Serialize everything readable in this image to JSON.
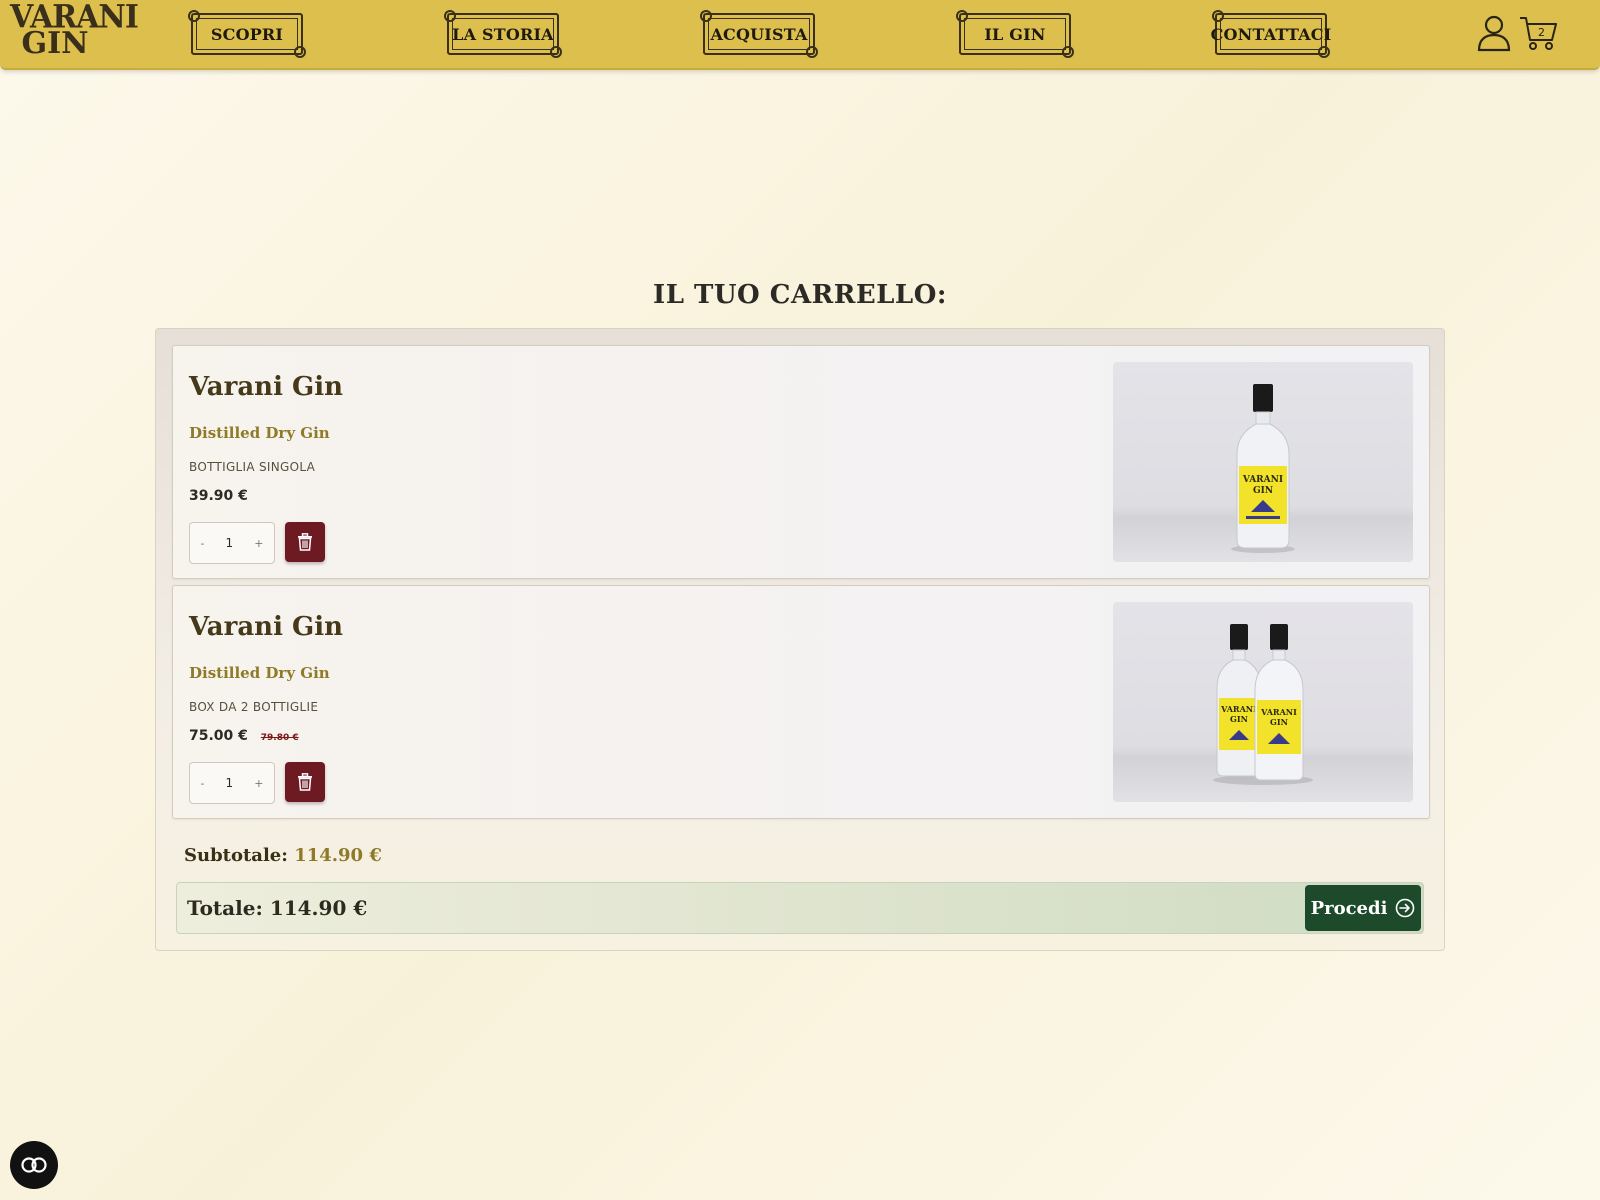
{
  "header": {
    "logo_line1": "VARANI",
    "logo_line2": "GIN",
    "nav": [
      {
        "label": "Scopri"
      },
      {
        "label": "La Storia"
      },
      {
        "label": "Acquista"
      },
      {
        "label": "Il Gin"
      },
      {
        "label": "Contattaci"
      }
    ],
    "cart_count": "2"
  },
  "page": {
    "title": "Il tuo carrello:"
  },
  "items": [
    {
      "name": "Varani Gin",
      "subtitle": "Distilled Dry Gin",
      "variant": "Bottiglia singola",
      "price": "39.90 €",
      "old_price": "",
      "quantity": "1",
      "dec": "-",
      "inc": "+"
    },
    {
      "name": "Varani Gin",
      "subtitle": "Distilled Dry Gin",
      "variant": "Box da 2 bottiglie",
      "price": "75.00 €",
      "old_price": "79.80 €",
      "quantity": "1",
      "dec": "-",
      "inc": "+"
    }
  ],
  "summary": {
    "subtotal_label": "Subtotale:",
    "subtotal_value": "114.90 €",
    "total_label": "Totale:",
    "total_value": "114.90 €",
    "proceed_label": "Procedi"
  },
  "colors": {
    "header_bg": "#dcbf4c",
    "accent_gold": "#8f7a28",
    "trash_red": "#6e1a22",
    "proceed_green": "#1d4a2a"
  },
  "icons": [
    "user-icon",
    "cart-icon",
    "trash-icon",
    "arrow-right-circle-icon",
    "accessibility-icon"
  ]
}
